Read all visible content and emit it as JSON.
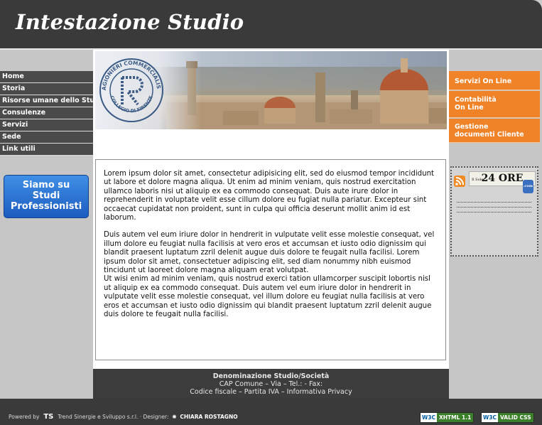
{
  "header": {
    "title": "Intestazione Studio"
  },
  "nav": {
    "items": [
      {
        "label": "Home"
      },
      {
        "label": "Storia"
      },
      {
        "label": "Risorse umane dello Studio"
      },
      {
        "label": "Consulenze"
      },
      {
        "label": "Servizi"
      },
      {
        "label": "Sede"
      },
      {
        "label": "Link utili"
      }
    ]
  },
  "promo": {
    "line1": "Siamo su",
    "line2": "Studi",
    "line3": "Professionisti"
  },
  "banner": {
    "seal_text_top": "RAGIONIERI COMMERCIALISTI",
    "seal_text_bottom": "COLLEGIO DI FIRENZE"
  },
  "content": {
    "p1": "Lorem ipsum dolor sit amet, consectetur adipisicing elit, sed do eiusmod tempor incididunt ut labore et dolore magna aliqua. Ut enim ad minim veniam, quis nostrud exercitation ullamco laboris nisi ut aliquip ex ea commodo consequat. Duis aute irure dolor in reprehenderit in voluptate velit esse cillum dolore eu fugiat nulla pariatur. Excepteur sint occaecat cupidatat non proident, sunt in culpa qui officia deserunt mollit anim id est laborum.",
    "p2": "Duis autem vel eum iriure dolor in hendrerit in vulputate velit esse molestie consequat, vel illum dolore eu feugiat nulla facilisis at vero eros et accumsan et iusto odio dignissim qui blandit praesent luptatum zzril delenit augue duis dolore te feugait nulla facilisi. Lorem ipsum dolor sit amet, consectetuer adipiscing elit, sed diam nonummy nibh euismod tincidunt ut laoreet dolore magna aliquam erat volutpat.",
    "p3": "Ut wisi enim ad minim veniam, quis nostrud exerci tation ullamcorper suscipit lobortis nisl ut aliquip ex ea commodo consequat. Duis autem vel eum iriure dolor in hendrerit in vulputate velit esse molestie consequat, vel illum dolore eu feugiat nulla facilisis at vero eros et accumsan et iusto odio dignissim qui blandit praesent luptatum zzril delenit augue duis dolore te feugait nulla facilisi."
  },
  "footer": {
    "name": "Denominazione Studio/Società",
    "address": "CAP Comune – Via – Tel.: - Fax:",
    "legal": "Codice fiscale – Partita IVA – Informativa Privacy"
  },
  "services": {
    "item1": "Servizi On Line",
    "item2_line1": "Contabilità",
    "item2_line2": "On Line",
    "item3_line1": "Gestione",
    "item3_line2": "documenti Cliente"
  },
  "feed": {
    "sole_top": "Il Sole",
    "sole_main": "24 ORE",
    "sole_suffix": ".com"
  },
  "bottom": {
    "powered": "Powered by",
    "company": "Trend Sinergie e Sviluppo s.r.l.",
    "designer_label": "· Designer:",
    "designer": "CHIARA ROSTAGNO",
    "badge1_w3": "W3C",
    "badge1_kind": "XHTML 1.1",
    "badge2_w3": "W3C",
    "badge2_kind": "VALID CSS"
  },
  "colors": {
    "accent": "#f08228",
    "dark": "#3a3a3a",
    "panel": "#c6c6c6"
  }
}
